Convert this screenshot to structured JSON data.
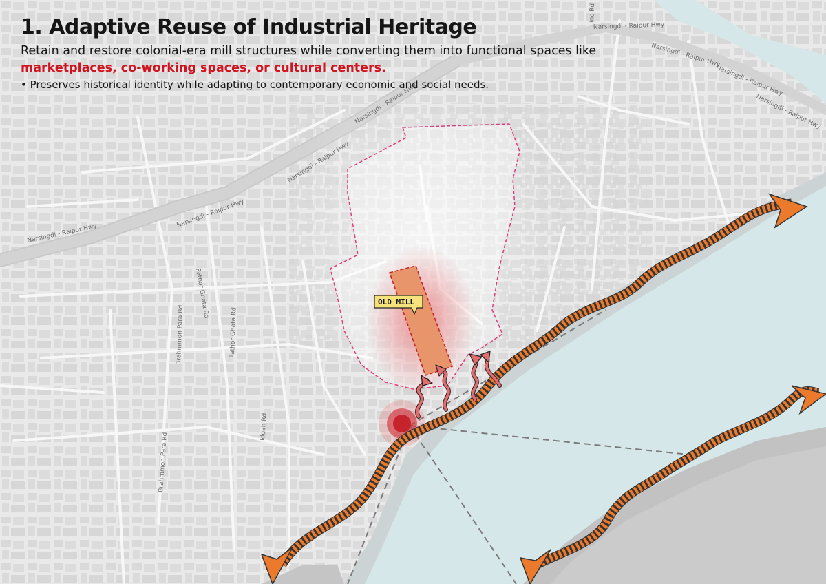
{
  "header": {
    "title": "1. Adaptive Reuse of Industrial Heritage",
    "description_plain": "Retain and restore colonial-era mill structures while converting them into functional spaces like ",
    "description_highlight": "marketplaces, co-working spaces, or cultural centers.",
    "bullet": "• Preserves historical identity while adapting to contemporary economic and social needs."
  },
  "colors": {
    "river": "#d6e7e9",
    "land": "#e9e9e9",
    "boundary": "#e0397c",
    "mill_fill": "#e8956c",
    "mill_stroke": "#c0282a",
    "arrow": "#ec7a2c",
    "highlight_text": "#d1141f",
    "tag_bg": "#f6e27a"
  },
  "map": {
    "road_labels": [
      {
        "text": "Narsingdi - Raipur Hwy"
      },
      {
        "text": "Narsingdi - Raipur Hwy"
      },
      {
        "text": "Narsingdi - Raipur Hwy"
      },
      {
        "text": "Narsingdi - Raipur Hwy"
      },
      {
        "text": "Narsingdi - Raipur Hwy"
      },
      {
        "text": "Narsingdi - Raipur Hwy"
      },
      {
        "text": "Narsingdi - Raipur Hwy"
      },
      {
        "text": "Narsingdi - Raipur Hwy"
      },
      {
        "text": "Pathor Ghata Rd"
      },
      {
        "text": "Pathor Ghata Rd"
      },
      {
        "text": "Brahmmon Para Rd"
      },
      {
        "text": "Brahmmon Para Rd"
      },
      {
        "text": "Idgah Rd"
      },
      {
        "text": "Linc Rd"
      }
    ],
    "mill_label": "OLD MILL",
    "icons": [
      "wind-flow-icon",
      "view-point-icon",
      "river-flow-arrow-icon"
    ]
  }
}
